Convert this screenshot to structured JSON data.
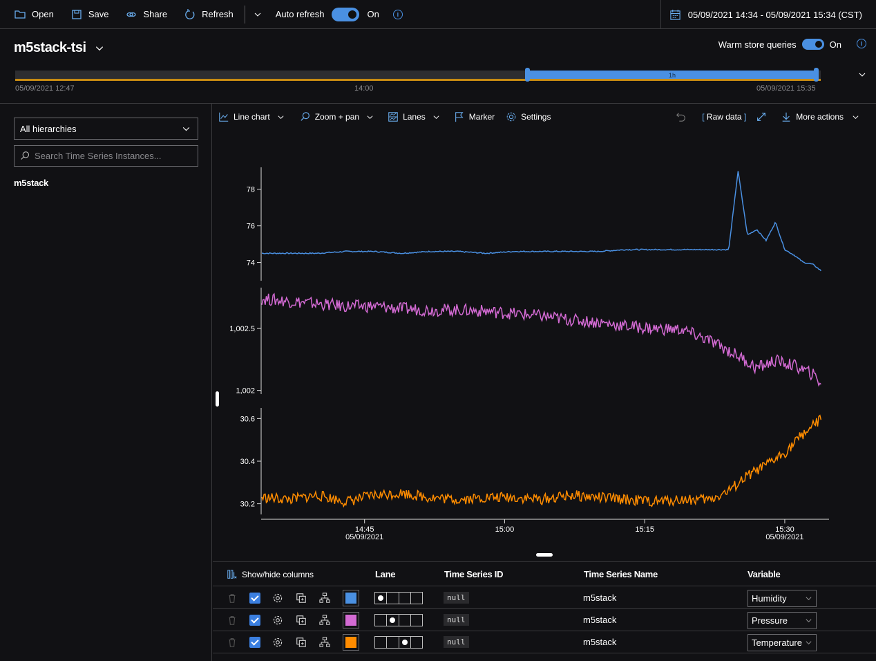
{
  "toolbar": {
    "open": "Open",
    "save": "Save",
    "share": "Share",
    "refresh": "Refresh",
    "auto_refresh": "Auto refresh",
    "auto_refresh_state": "On",
    "date_range": "05/09/2021 14:34 - 05/09/2021 15:34 (CST)"
  },
  "environment": {
    "name": "m5stack-tsi",
    "warm_store_label": "Warm store queries",
    "warm_store_state": "On"
  },
  "timeline": {
    "start_label": "05/09/2021 12:47",
    "mid_label": "14:00",
    "end_label": "05/09/2021 15:35",
    "selection_label": "1h"
  },
  "left_pane": {
    "hierarchy_select": "All hierarchies",
    "search_placeholder": "Search Time Series Instances...",
    "tree_item": "m5stack"
  },
  "chart_toolbar": {
    "line_chart": "Line chart",
    "zoom_pan": "Zoom + pan",
    "lanes": "Lanes",
    "marker": "Marker",
    "settings": "Settings",
    "raw_data_open": "[",
    "raw_data": "Raw data",
    "raw_data_close": "]",
    "more_actions": "More actions"
  },
  "colors": {
    "humidity": "#4a90e2",
    "pressure": "#d36ad3",
    "temperature": "#ff8c00",
    "accent": "#4a90e2",
    "timeline_bar": "#c88b12"
  },
  "chart_data": {
    "type": "line",
    "x_ticks": [
      {
        "time": "14:45",
        "date": "05/09/2021"
      },
      {
        "time": "15:00",
        "date": ""
      },
      {
        "time": "15:15",
        "date": ""
      },
      {
        "time": "15:30",
        "date": "05/09/2021"
      }
    ],
    "lanes": [
      {
        "variable": "Humidity",
        "color": "#4a90e2",
        "y_ticks": [
          "78",
          "76",
          "74"
        ],
        "y_tick_values": [
          78,
          76,
          74
        ],
        "ylim": [
          73.0,
          79.2
        ],
        "x": [
          "14:34",
          "14:37",
          "14:40",
          "14:43",
          "14:46",
          "14:49",
          "14:52",
          "14:55",
          "14:58",
          "15:01",
          "15:04",
          "15:07",
          "15:10",
          "15:13",
          "15:16",
          "15:19",
          "15:22",
          "15:24",
          "15:25",
          "15:26",
          "15:27",
          "15:28",
          "15:29",
          "15:30",
          "15:31",
          "15:32",
          "15:33",
          "15:34"
        ],
        "values": [
          74.5,
          74.5,
          74.5,
          74.6,
          74.6,
          74.5,
          74.6,
          74.6,
          74.5,
          74.6,
          74.6,
          74.6,
          74.6,
          74.7,
          74.7,
          74.7,
          74.7,
          74.7,
          79.0,
          75.5,
          75.8,
          75.2,
          76.2,
          74.7,
          74.4,
          74.0,
          73.9,
          73.5
        ]
      },
      {
        "variable": "Pressure",
        "color": "#d36ad3",
        "y_ticks": [
          "1,002.5",
          "1,002"
        ],
        "y_tick_values": [
          1002.5,
          1002
        ],
        "ylim": [
          1001.97,
          1002.83
        ],
        "x": [
          "14:34",
          "14:37",
          "14:40",
          "14:43",
          "14:46",
          "14:49",
          "14:52",
          "14:55",
          "14:58",
          "15:01",
          "15:04",
          "15:07",
          "15:10",
          "15:13",
          "15:16",
          "15:19",
          "15:22",
          "15:25",
          "15:27",
          "15:29",
          "15:31",
          "15:33",
          "15:34"
        ],
        "values": [
          1002.74,
          1002.72,
          1002.7,
          1002.68,
          1002.68,
          1002.66,
          1002.65,
          1002.65,
          1002.64,
          1002.62,
          1002.6,
          1002.57,
          1002.55,
          1002.52,
          1002.5,
          1002.49,
          1002.4,
          1002.28,
          1002.18,
          1002.24,
          1002.2,
          1002.13,
          1002.05
        ]
      },
      {
        "variable": "Temperature",
        "color": "#ff8c00",
        "y_ticks": [
          "30.6",
          "30.4",
          "30.2"
        ],
        "y_tick_values": [
          30.6,
          30.4,
          30.2
        ],
        "ylim": [
          30.15,
          30.65
        ],
        "x": [
          "14:34",
          "14:37",
          "14:40",
          "14:43",
          "14:46",
          "14:49",
          "14:52",
          "14:55",
          "14:58",
          "15:01",
          "15:04",
          "15:07",
          "15:10",
          "15:13",
          "15:16",
          "15:19",
          "15:22",
          "15:24",
          "15:26",
          "15:28",
          "15:30",
          "15:32",
          "15:34"
        ],
        "values": [
          30.23,
          30.22,
          30.24,
          30.21,
          30.24,
          30.25,
          30.23,
          30.22,
          30.23,
          30.23,
          30.22,
          30.24,
          30.23,
          30.22,
          30.21,
          30.22,
          30.22,
          30.26,
          30.33,
          30.38,
          30.44,
          30.53,
          30.6
        ]
      }
    ]
  },
  "legend": {
    "show_hide": "Show/hide columns",
    "col_lane": "Lane",
    "col_id": "Time Series ID",
    "col_name": "Time Series Name",
    "col_variable": "Variable",
    "rows": [
      {
        "id": "null",
        "name": "m5stack",
        "variable": "Humidity",
        "lane": 0,
        "color": "#4a90e2"
      },
      {
        "id": "null",
        "name": "m5stack",
        "variable": "Pressure",
        "lane": 1,
        "color": "#d36ad3"
      },
      {
        "id": "null",
        "name": "m5stack",
        "variable": "Temperature",
        "lane": 2,
        "color": "#ff8c00"
      }
    ]
  }
}
